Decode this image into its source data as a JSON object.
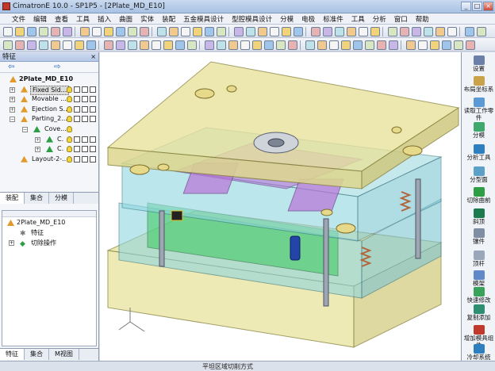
{
  "window": {
    "title": "CimatronE 10.0 - SP1P5 - [2Plate_MD_E10]",
    "buttons": [
      "_",
      "□",
      "×"
    ]
  },
  "menubar": {
    "items": [
      "文件",
      "编辑",
      "查看",
      "工具",
      "插入",
      "曲面",
      "实体",
      "装配",
      "五金模具设计",
      "型腔模具设计",
      "分模",
      "电极",
      "标准件",
      "工具",
      "分析",
      "窗口",
      "帮助"
    ]
  },
  "feature_panel": {
    "title": "特征",
    "close_label": "×",
    "nav_back": "⇦",
    "nav_forward": "⇨",
    "tree": [
      {
        "label": "2Plate_MD_E10",
        "level": 0
      },
      {
        "label": "Fixed Sid...",
        "level": 1
      },
      {
        "label": "Movable ...",
        "level": 1
      },
      {
        "label": "Ejection S...",
        "level": 1
      },
      {
        "label": "Parting_2...",
        "level": 1
      },
      {
        "label": "Cove...",
        "level": 2
      },
      {
        "label": "C.",
        "level": 3
      },
      {
        "label": "C.",
        "level": 3
      },
      {
        "label": "Layout-2-...",
        "level": 1
      }
    ],
    "tabs": [
      "装配",
      "集合",
      "分模"
    ]
  },
  "history_panel": {
    "tree": [
      {
        "label": "2Plate_MD_E10",
        "level": 0
      },
      {
        "label": "特征",
        "level": 1
      },
      {
        "label": "切除操作",
        "level": 1
      }
    ],
    "tabs": [
      "特征",
      "集合",
      "M视图"
    ]
  },
  "right_panel": {
    "items": [
      "设置",
      "布局坐标系",
      "读取工作零件",
      "分模",
      "分析工具",
      "分型面",
      "切除曲前",
      "斜顶",
      "镶件",
      "顶杆",
      "模架",
      "快速修改",
      "复制添加",
      "增加模具组件",
      "冷却系统"
    ]
  },
  "status": {
    "text": "平坦区域切削方式"
  },
  "colors": {
    "plate_yellow": "#e8e29a",
    "plate_cyan": "#8fd6e0",
    "cavity_purple": "#b774d8",
    "core_green": "#38c95a",
    "titlebar": "#b8cce8"
  }
}
